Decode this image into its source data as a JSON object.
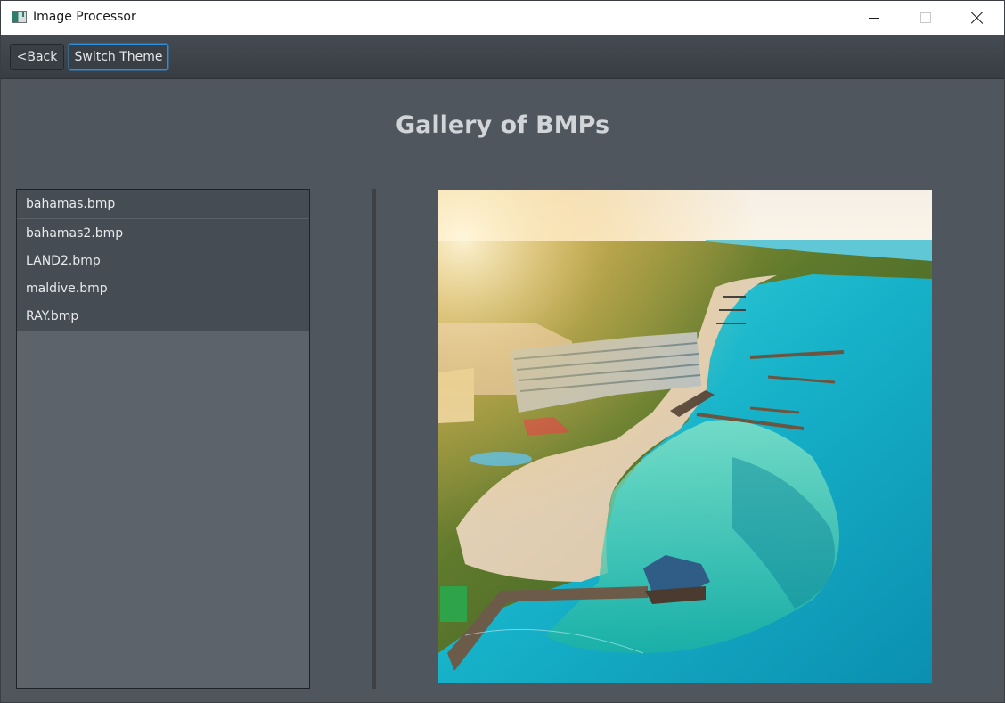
{
  "window": {
    "title": "Image Processor",
    "controls": {
      "minimize": "minimize-icon",
      "maximize": "maximize-icon",
      "close": "close-icon"
    }
  },
  "toolbar": {
    "back_label": "<Back",
    "switch_theme_label": "Switch Theme"
  },
  "main": {
    "title": "Gallery of BMPs",
    "files": [
      {
        "name": "bahamas.bmp",
        "selected": true
      },
      {
        "name": "bahamas2.bmp",
        "selected": false
      },
      {
        "name": "LAND2.bmp",
        "selected": false
      },
      {
        "name": "maldive.bmp",
        "selected": false
      },
      {
        "name": "RAY.bmp",
        "selected": false
      }
    ],
    "preview": {
      "description": "Aerial photo of a Bahamas beachfront resort with turquoise water and piers"
    }
  },
  "colors": {
    "background": "#50565d",
    "toolbar": "#3f444a",
    "focus_accent": "#2d8fe0",
    "title_text": "#d2d5d8",
    "list_item_bg": "#454c53"
  }
}
